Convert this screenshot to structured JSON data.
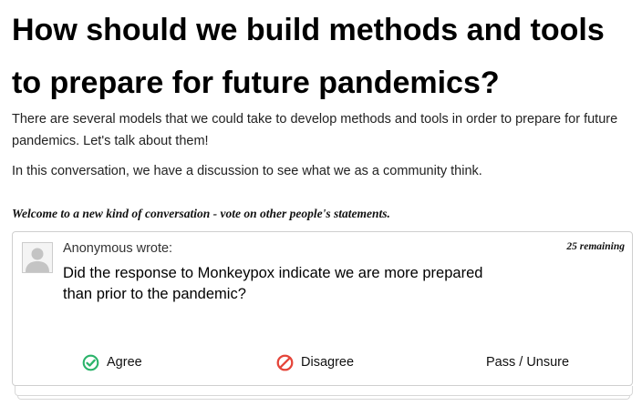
{
  "conversation": {
    "heading": "How should we build methods and tools to prepare for future pandemics?",
    "description": "There are several models that we could take to develop methods and tools in order to prepare for future pandemics. Let's talk about them!",
    "intro": "In this conversation, we have a discussion to see what we as a community think."
  },
  "welcome_text": "Welcome to a new kind of conversation - vote on other people's statements.",
  "card": {
    "author": "Anonymous wrote:",
    "remaining": "25 remaining",
    "statement": "Did the response to Monkeypox indicate we are more prepared than prior to the pandemic?"
  },
  "votes": {
    "agree_label": "Agree",
    "disagree_label": "Disagree",
    "pass_label": "Pass / Unsure"
  },
  "colors": {
    "agree": "#2bb36a",
    "disagree": "#e5453a",
    "avatar_gray": "#c4c4c4"
  },
  "icons": {
    "agree": "check-circle-icon",
    "disagree": "ban-icon",
    "avatar": "user-silhouette-icon"
  }
}
